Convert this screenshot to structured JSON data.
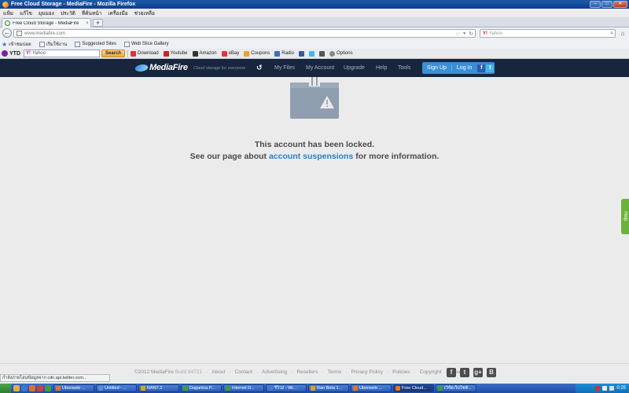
{
  "window": {
    "title": "Free Cloud Storage - MediaFire - Mozilla Firefox",
    "min_label": "–",
    "max_label": "□",
    "close_label": "✕"
  },
  "menu": [
    "แฟ้ม",
    "แก้ไข",
    "มุมมอง",
    "ประวัติ",
    "ที่คั่นหน้า",
    "เครื่องมือ",
    "ช่วยเหลือ"
  ],
  "tab": {
    "label": "Free Cloud Storage - MediaFire",
    "close": "×",
    "new_tab": "+"
  },
  "nav": {
    "url": "www.mediafire.com",
    "search_engine": "Y!",
    "search_placeholder": "Yahoo",
    "back_glyph": "←",
    "home_glyph": "⌂"
  },
  "bookmarks": [
    {
      "label": "เข้าชมบ่อย",
      "icon": "star-icon"
    },
    {
      "label": "เริ่มใช้งาน",
      "icon": "page-icon"
    },
    {
      "label": "Suggested Sites",
      "icon": "page-icon"
    },
    {
      "label": "Web Slice Gallery",
      "icon": "page-icon"
    }
  ],
  "yahoo_toolbar": {
    "ytd": "YTD",
    "logo": "Y!",
    "input_value": "Yahoo",
    "search_button": "Search",
    "tools": [
      {
        "label": "Download",
        "color": "#d9372b"
      },
      {
        "label": "Youtube",
        "color": "#cc2222"
      },
      {
        "label": "Amazon",
        "color": "#333333"
      },
      {
        "label": "eBay",
        "color": "#e53238"
      },
      {
        "label": "Coupons",
        "color": "#f0a030"
      },
      {
        "label": "Radio",
        "color": "#3a6fc4"
      },
      {
        "label": "",
        "color": "#3b5998"
      },
      {
        "label": "",
        "color": "#41b7ea"
      },
      {
        "label": "",
        "color": "#555555"
      },
      {
        "label": "Options",
        "color": "#888888"
      }
    ]
  },
  "mediafire": {
    "logo": "MediaFire",
    "tagline": "Cloud storage for everyone",
    "nav": [
      "My Files",
      "My Account",
      "Upgrade",
      "Help",
      "Tools"
    ],
    "signup": "Sign Up",
    "login": "Log In",
    "fb": "f",
    "tw": "t"
  },
  "message": {
    "line1": "This account has been locked.",
    "line2_prefix": "See our page about ",
    "line2_link": "account suspensions",
    "line2_suffix": " for more information."
  },
  "help_tab": "Help",
  "footer": {
    "copyright": "©2012 MediaFire",
    "build": "Build 84721",
    "links": [
      "About",
      "Contact",
      "Advertising",
      "Resellers",
      "Terms",
      "Privacy Policy",
      "Policies",
      "Copyright",
      "Abuse"
    ],
    "social": [
      "f",
      "t",
      "g+",
      "B"
    ]
  },
  "statusbar": "กำลังถ่ายโอนข้อมูลจาก cdn.api.twitter.com...",
  "taskbar": {
    "tasks": [
      {
        "label": "Ubonweb ...",
        "color": "#e8731f"
      },
      {
        "label": "Untitled - ...",
        "color": "#5a8fd8"
      },
      {
        "label": "RAN7.2",
        "color": "#d8a31f"
      },
      {
        "label": "Daganica P...",
        "color": "#3a9e3a"
      },
      {
        "label": "Internet D...",
        "color": "#3a9e3a"
      },
      {
        "label": "รีวิว2 - Wi...",
        "color": "#4a78c8"
      },
      {
        "label": "Ran Beta 1...",
        "color": "#d8a31f"
      },
      {
        "label": "Ubonweb ...",
        "color": "#e8731f"
      },
      {
        "label": "Free Cloud...",
        "color": "#e8731f",
        "active": true
      },
      {
        "label": "เวิร์ดเว็บไซต์...",
        "color": "#3a9e3a"
      }
    ],
    "clock": "0:25"
  }
}
